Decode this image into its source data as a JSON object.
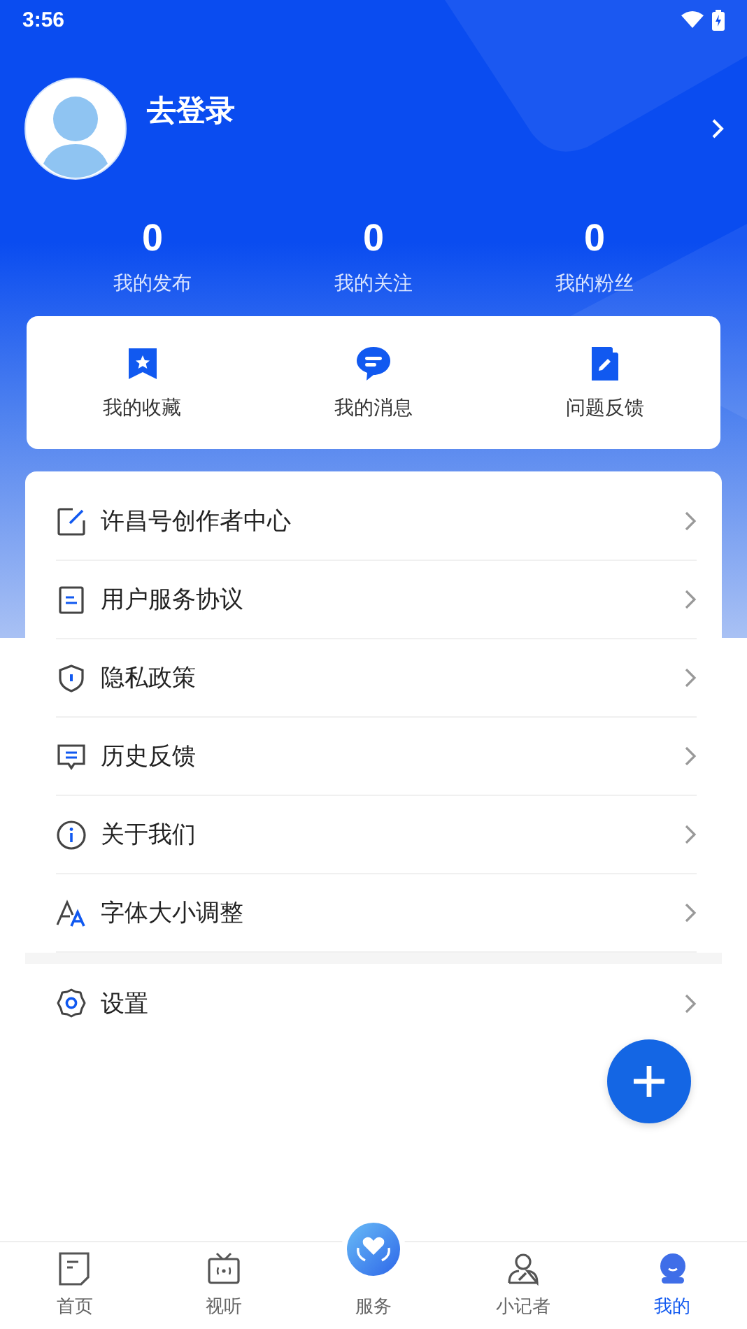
{
  "status_bar": {
    "time": "3:56"
  },
  "profile": {
    "login_label": "去登录"
  },
  "stats": [
    {
      "value": "0",
      "label": "我的发布"
    },
    {
      "value": "0",
      "label": "我的关注"
    },
    {
      "value": "0",
      "label": "我的粉丝"
    }
  ],
  "shortcuts": [
    {
      "label": "我的收藏"
    },
    {
      "label": "我的消息"
    },
    {
      "label": "问题反馈"
    }
  ],
  "menu": [
    {
      "label": "许昌号创作者中心"
    },
    {
      "label": "用户服务协议"
    },
    {
      "label": "隐私政策"
    },
    {
      "label": "历史反馈"
    },
    {
      "label": "关于我们"
    },
    {
      "label": "字体大小调整"
    }
  ],
  "settings": {
    "label": "设置"
  },
  "bottom_nav": [
    {
      "label": "首页",
      "selected": false
    },
    {
      "label": "视听",
      "selected": false
    },
    {
      "label": "服务",
      "selected": false
    },
    {
      "label": "小记者",
      "selected": false
    },
    {
      "label": "我的",
      "selected": true
    }
  ]
}
